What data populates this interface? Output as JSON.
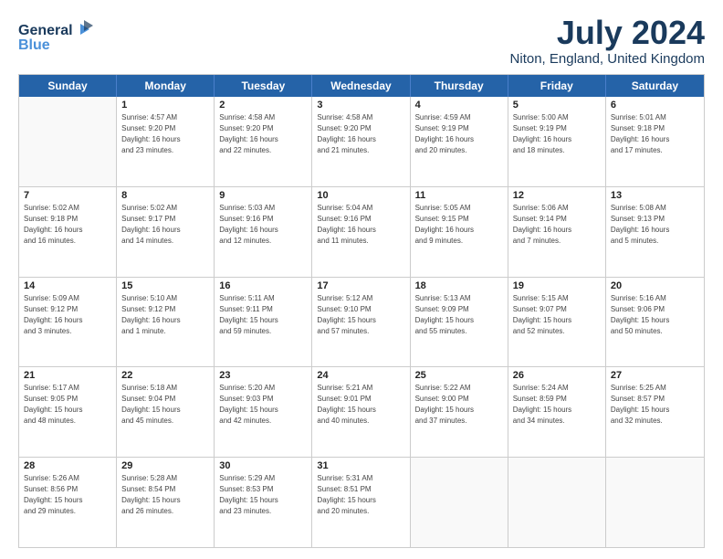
{
  "logo": {
    "line1": "General",
    "line2": "Blue"
  },
  "title": "July 2024",
  "subtitle": "Niton, England, United Kingdom",
  "header_days": [
    "Sunday",
    "Monday",
    "Tuesday",
    "Wednesday",
    "Thursday",
    "Friday",
    "Saturday"
  ],
  "weeks": [
    [
      {
        "day": "",
        "lines": []
      },
      {
        "day": "1",
        "lines": [
          "Sunrise: 4:57 AM",
          "Sunset: 9:20 PM",
          "Daylight: 16 hours",
          "and 23 minutes."
        ]
      },
      {
        "day": "2",
        "lines": [
          "Sunrise: 4:58 AM",
          "Sunset: 9:20 PM",
          "Daylight: 16 hours",
          "and 22 minutes."
        ]
      },
      {
        "day": "3",
        "lines": [
          "Sunrise: 4:58 AM",
          "Sunset: 9:20 PM",
          "Daylight: 16 hours",
          "and 21 minutes."
        ]
      },
      {
        "day": "4",
        "lines": [
          "Sunrise: 4:59 AM",
          "Sunset: 9:19 PM",
          "Daylight: 16 hours",
          "and 20 minutes."
        ]
      },
      {
        "day": "5",
        "lines": [
          "Sunrise: 5:00 AM",
          "Sunset: 9:19 PM",
          "Daylight: 16 hours",
          "and 18 minutes."
        ]
      },
      {
        "day": "6",
        "lines": [
          "Sunrise: 5:01 AM",
          "Sunset: 9:18 PM",
          "Daylight: 16 hours",
          "and 17 minutes."
        ]
      }
    ],
    [
      {
        "day": "7",
        "lines": [
          "Sunrise: 5:02 AM",
          "Sunset: 9:18 PM",
          "Daylight: 16 hours",
          "and 16 minutes."
        ]
      },
      {
        "day": "8",
        "lines": [
          "Sunrise: 5:02 AM",
          "Sunset: 9:17 PM",
          "Daylight: 16 hours",
          "and 14 minutes."
        ]
      },
      {
        "day": "9",
        "lines": [
          "Sunrise: 5:03 AM",
          "Sunset: 9:16 PM",
          "Daylight: 16 hours",
          "and 12 minutes."
        ]
      },
      {
        "day": "10",
        "lines": [
          "Sunrise: 5:04 AM",
          "Sunset: 9:16 PM",
          "Daylight: 16 hours",
          "and 11 minutes."
        ]
      },
      {
        "day": "11",
        "lines": [
          "Sunrise: 5:05 AM",
          "Sunset: 9:15 PM",
          "Daylight: 16 hours",
          "and 9 minutes."
        ]
      },
      {
        "day": "12",
        "lines": [
          "Sunrise: 5:06 AM",
          "Sunset: 9:14 PM",
          "Daylight: 16 hours",
          "and 7 minutes."
        ]
      },
      {
        "day": "13",
        "lines": [
          "Sunrise: 5:08 AM",
          "Sunset: 9:13 PM",
          "Daylight: 16 hours",
          "and 5 minutes."
        ]
      }
    ],
    [
      {
        "day": "14",
        "lines": [
          "Sunrise: 5:09 AM",
          "Sunset: 9:12 PM",
          "Daylight: 16 hours",
          "and 3 minutes."
        ]
      },
      {
        "day": "15",
        "lines": [
          "Sunrise: 5:10 AM",
          "Sunset: 9:12 PM",
          "Daylight: 16 hours",
          "and 1 minute."
        ]
      },
      {
        "day": "16",
        "lines": [
          "Sunrise: 5:11 AM",
          "Sunset: 9:11 PM",
          "Daylight: 15 hours",
          "and 59 minutes."
        ]
      },
      {
        "day": "17",
        "lines": [
          "Sunrise: 5:12 AM",
          "Sunset: 9:10 PM",
          "Daylight: 15 hours",
          "and 57 minutes."
        ]
      },
      {
        "day": "18",
        "lines": [
          "Sunrise: 5:13 AM",
          "Sunset: 9:09 PM",
          "Daylight: 15 hours",
          "and 55 minutes."
        ]
      },
      {
        "day": "19",
        "lines": [
          "Sunrise: 5:15 AM",
          "Sunset: 9:07 PM",
          "Daylight: 15 hours",
          "and 52 minutes."
        ]
      },
      {
        "day": "20",
        "lines": [
          "Sunrise: 5:16 AM",
          "Sunset: 9:06 PM",
          "Daylight: 15 hours",
          "and 50 minutes."
        ]
      }
    ],
    [
      {
        "day": "21",
        "lines": [
          "Sunrise: 5:17 AM",
          "Sunset: 9:05 PM",
          "Daylight: 15 hours",
          "and 48 minutes."
        ]
      },
      {
        "day": "22",
        "lines": [
          "Sunrise: 5:18 AM",
          "Sunset: 9:04 PM",
          "Daylight: 15 hours",
          "and 45 minutes."
        ]
      },
      {
        "day": "23",
        "lines": [
          "Sunrise: 5:20 AM",
          "Sunset: 9:03 PM",
          "Daylight: 15 hours",
          "and 42 minutes."
        ]
      },
      {
        "day": "24",
        "lines": [
          "Sunrise: 5:21 AM",
          "Sunset: 9:01 PM",
          "Daylight: 15 hours",
          "and 40 minutes."
        ]
      },
      {
        "day": "25",
        "lines": [
          "Sunrise: 5:22 AM",
          "Sunset: 9:00 PM",
          "Daylight: 15 hours",
          "and 37 minutes."
        ]
      },
      {
        "day": "26",
        "lines": [
          "Sunrise: 5:24 AM",
          "Sunset: 8:59 PM",
          "Daylight: 15 hours",
          "and 34 minutes."
        ]
      },
      {
        "day": "27",
        "lines": [
          "Sunrise: 5:25 AM",
          "Sunset: 8:57 PM",
          "Daylight: 15 hours",
          "and 32 minutes."
        ]
      }
    ],
    [
      {
        "day": "28",
        "lines": [
          "Sunrise: 5:26 AM",
          "Sunset: 8:56 PM",
          "Daylight: 15 hours",
          "and 29 minutes."
        ]
      },
      {
        "day": "29",
        "lines": [
          "Sunrise: 5:28 AM",
          "Sunset: 8:54 PM",
          "Daylight: 15 hours",
          "and 26 minutes."
        ]
      },
      {
        "day": "30",
        "lines": [
          "Sunrise: 5:29 AM",
          "Sunset: 8:53 PM",
          "Daylight: 15 hours",
          "and 23 minutes."
        ]
      },
      {
        "day": "31",
        "lines": [
          "Sunrise: 5:31 AM",
          "Sunset: 8:51 PM",
          "Daylight: 15 hours",
          "and 20 minutes."
        ]
      },
      {
        "day": "",
        "lines": []
      },
      {
        "day": "",
        "lines": []
      },
      {
        "day": "",
        "lines": []
      }
    ]
  ]
}
